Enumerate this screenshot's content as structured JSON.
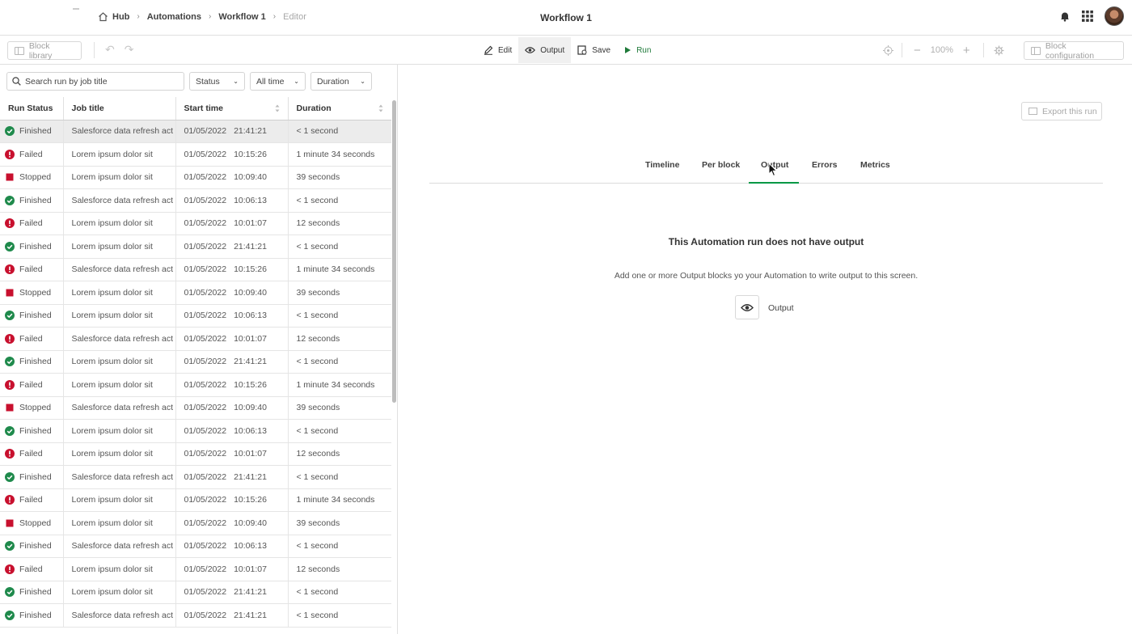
{
  "header": {
    "breadcrumbs": [
      "Hub",
      "Automations",
      "Workflow 1",
      "Editor"
    ],
    "title": "Workflow 1"
  },
  "toolbar": {
    "block_library": "Block library",
    "edit": "Edit",
    "output": "Output",
    "save": "Save",
    "run": "Run",
    "zoom": "100%",
    "block_configuration": "Block configuration"
  },
  "filters": {
    "search_placeholder": "Search run by job title",
    "status": "Status",
    "time": "All time",
    "duration": "Duration"
  },
  "table": {
    "columns": [
      "Run Status",
      "Job title",
      "Start time",
      "Duration"
    ],
    "rows": [
      {
        "status": "Finished",
        "job": "Salesforce data refresh act",
        "date": "01/05/2022",
        "time": "21:41:21",
        "duration": "< 1 second"
      },
      {
        "status": "Failed",
        "job": "Lorem ipsum dolor sit",
        "date": "01/05/2022",
        "time": "10:15:26",
        "duration": "1 minute 34 seconds"
      },
      {
        "status": "Stopped",
        "job": "Lorem ipsum dolor sit",
        "date": "01/05/2022",
        "time": "10:09:40",
        "duration": "39 seconds"
      },
      {
        "status": "Finished",
        "job": "Salesforce data refresh act",
        "date": "01/05/2022",
        "time": "10:06:13",
        "duration": "< 1 second"
      },
      {
        "status": "Failed",
        "job": "Lorem ipsum dolor sit",
        "date": "01/05/2022",
        "time": "10:01:07",
        "duration": "12 seconds"
      },
      {
        "status": "Finished",
        "job": "Lorem ipsum dolor sit",
        "date": "01/05/2022",
        "time": "21:41:21",
        "duration": "< 1 second"
      },
      {
        "status": "Failed",
        "job": "Salesforce data refresh act",
        "date": "01/05/2022",
        "time": "10:15:26",
        "duration": "1 minute 34 seconds"
      },
      {
        "status": "Stopped",
        "job": "Lorem ipsum dolor sit",
        "date": "01/05/2022",
        "time": "10:09:40",
        "duration": "39 seconds"
      },
      {
        "status": "Finished",
        "job": "Lorem ipsum dolor sit",
        "date": "01/05/2022",
        "time": "10:06:13",
        "duration": "< 1 second"
      },
      {
        "status": "Failed",
        "job": "Salesforce data refresh act",
        "date": "01/05/2022",
        "time": "10:01:07",
        "duration": "12 seconds"
      },
      {
        "status": "Finished",
        "job": "Lorem ipsum dolor sit",
        "date": "01/05/2022",
        "time": "21:41:21",
        "duration": "< 1 second"
      },
      {
        "status": "Failed",
        "job": "Lorem ipsum dolor sit",
        "date": "01/05/2022",
        "time": "10:15:26",
        "duration": "1 minute 34 seconds"
      },
      {
        "status": "Stopped",
        "job": "Salesforce data refresh act",
        "date": "01/05/2022",
        "time": "10:09:40",
        "duration": "39 seconds"
      },
      {
        "status": "Finished",
        "job": "Lorem ipsum dolor sit",
        "date": "01/05/2022",
        "time": "10:06:13",
        "duration": "< 1 second"
      },
      {
        "status": "Failed",
        "job": "Lorem ipsum dolor sit",
        "date": "01/05/2022",
        "time": "10:01:07",
        "duration": "12 seconds"
      },
      {
        "status": "Finished",
        "job": "Salesforce data refresh act",
        "date": "01/05/2022",
        "time": "21:41:21",
        "duration": "< 1 second"
      },
      {
        "status": "Failed",
        "job": "Lorem ipsum dolor sit",
        "date": "01/05/2022",
        "time": "10:15:26",
        "duration": "1 minute 34 seconds"
      },
      {
        "status": "Stopped",
        "job": "Lorem ipsum dolor sit",
        "date": "01/05/2022",
        "time": "10:09:40",
        "duration": "39 seconds"
      },
      {
        "status": "Finished",
        "job": "Salesforce data refresh act",
        "date": "01/05/2022",
        "time": "10:06:13",
        "duration": "< 1 second"
      },
      {
        "status": "Failed",
        "job": "Lorem ipsum dolor sit",
        "date": "01/05/2022",
        "time": "10:01:07",
        "duration": "12 seconds"
      },
      {
        "status": "Finished",
        "job": "Lorem ipsum dolor sit",
        "date": "01/05/2022",
        "time": "21:41:21",
        "duration": "< 1 second"
      },
      {
        "status": "Finished",
        "job": "Salesforce data refresh act",
        "date": "01/05/2022",
        "time": "21:41:21",
        "duration": "< 1 second"
      }
    ]
  },
  "panel": {
    "export": "Export this run",
    "tabs": [
      "Timeline",
      "Per block",
      "Output",
      "Errors",
      "Metrics"
    ],
    "active_tab": "Output",
    "empty_title": "This Automation run does not have output",
    "empty_desc": "Add one or more Output blocks yo your Automation to write output to this screen.",
    "output_label": "Output"
  },
  "colors": {
    "finished": "#1f8a4c",
    "failed": "#c8102e",
    "stopped": "#c8102e",
    "accent": "#009845"
  },
  "icons": {
    "Finished": "check-circle-icon",
    "Failed": "exclamation-circle-icon",
    "Stopped": "stop-square-icon"
  }
}
